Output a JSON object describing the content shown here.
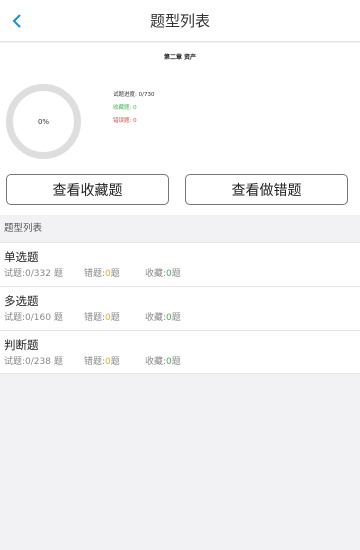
{
  "header": {
    "title": "题型列表",
    "back_icon": "chevron-left-icon"
  },
  "overview": {
    "chapter": "第二章 资产",
    "progress_percent": "0%",
    "progress_label": "试题进度: 0/730",
    "favorites_label": "收藏题: 0",
    "wrong_label": "错误题: 0"
  },
  "actions": {
    "view_favorites": "查看收藏题",
    "view_wrong": "查看做错题"
  },
  "list": {
    "section_title": "题型列表",
    "items": [
      {
        "title": "单选题",
        "count": "试题:0/332 题",
        "wrong_prefix": "错题:",
        "wrong_num": "0",
        "wrong_suffix": "题",
        "fav_prefix": "收藏:",
        "fav_num": "0",
        "fav_suffix": "题"
      },
      {
        "title": "多选题",
        "count": "试题:0/160 题",
        "wrong_prefix": "错题:",
        "wrong_num": "0",
        "wrong_suffix": "题",
        "fav_prefix": "收藏:",
        "fav_num": "0",
        "fav_suffix": "题"
      },
      {
        "title": "判断题",
        "count": "试题:0/238 题",
        "wrong_prefix": "错题:",
        "wrong_num": "0",
        "wrong_suffix": "题",
        "fav_prefix": "收藏:",
        "fav_num": "0",
        "fav_suffix": "题"
      }
    ]
  },
  "colors": {
    "accent": "#1a8fd8",
    "favorite": "#3cb54a",
    "wrong": "#e0473f",
    "wrong_count": "#f5a623"
  }
}
